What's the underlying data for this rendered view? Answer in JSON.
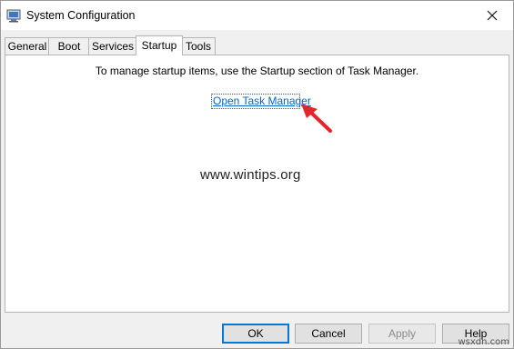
{
  "window": {
    "title": "System Configuration"
  },
  "tabs": [
    {
      "label": "General"
    },
    {
      "label": "Boot"
    },
    {
      "label": "Services"
    },
    {
      "label": "Startup",
      "active": true
    },
    {
      "label": "Tools"
    }
  ],
  "startup": {
    "message": "To manage startup items, use the Startup section of Task Manager.",
    "link_label": "Open Task Manager"
  },
  "watermark": "www.wintips.org",
  "buttons": {
    "ok": "OK",
    "cancel": "Cancel",
    "apply": "Apply",
    "help": "Help"
  },
  "corner_mark": "wsxdn.com",
  "colors": {
    "link": "#0066cc",
    "arrow": "#e3262b",
    "default_button_border": "#0078d7"
  },
  "icons": {
    "app": "system-configuration-icon",
    "close": "close-icon",
    "annotation": "red-arrow-icon"
  }
}
